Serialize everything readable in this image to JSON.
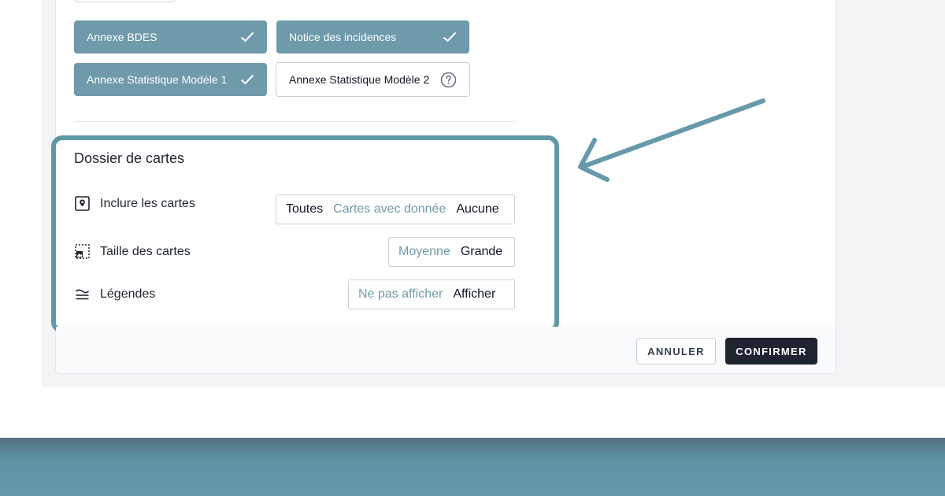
{
  "documents": {
    "chips": [
      {
        "label": "Annexe BDES",
        "state": "selected",
        "icon": "check-icon"
      },
      {
        "label": "Notice des incidences",
        "state": "selected",
        "icon": "check-icon"
      },
      {
        "label": "Annexe Statistique Modèle 1",
        "state": "selected",
        "icon": "check-icon"
      },
      {
        "label": "Annexe Statistique Modèle 2",
        "state": "unselected",
        "icon": "help-circle-icon"
      }
    ]
  },
  "maps_section": {
    "title": "Dossier de cartes",
    "rows": [
      {
        "label": "Inclure les cartes",
        "icon": "map-pin-icon",
        "options": [
          "Toutes",
          "Cartes avec donnée",
          "Aucune"
        ],
        "selected": [
          "Toutes",
          "Aucune"
        ]
      },
      {
        "label": "Taille des cartes",
        "icon": "image-size-icon",
        "options": [
          "Moyenne",
          "Grande"
        ],
        "selected": [
          "Grande"
        ]
      },
      {
        "label": "Légendes",
        "icon": "legend-waves-icon",
        "options": [
          "Ne pas afficher",
          "Afficher"
        ],
        "selected": [
          "Afficher"
        ]
      }
    ]
  },
  "footer": {
    "cancel_label": "ANNULER",
    "confirm_label": "CONFIRMER"
  },
  "colors": {
    "accent": "#6f9aaa",
    "highlight_border": "#5f97a8",
    "confirm_bg": "#1f2431",
    "bottom_band": "#6499aa"
  }
}
